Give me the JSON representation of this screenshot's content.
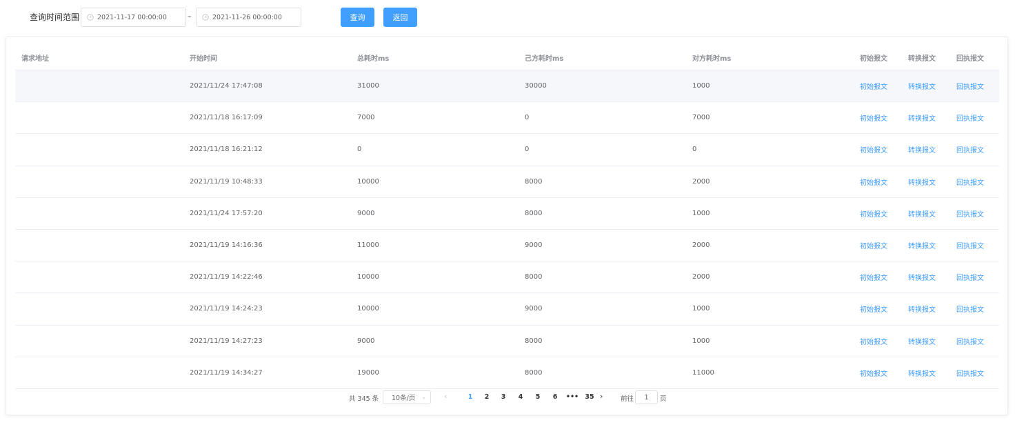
{
  "filter": {
    "range_label": "查询时间范围",
    "start_value": "2021-11-17 00:00:00",
    "end_value": "2021-11-26 00:00:00",
    "separator": "–",
    "query_label": "查询",
    "back_label": "返回"
  },
  "table": {
    "headers": [
      "请求地址",
      "开始时间",
      "总耗时ms",
      "己方耗时ms",
      "对方耗时ms",
      "初始报文",
      "转换报文",
      "回执报文"
    ],
    "rows": [
      {
        "url": "",
        "start": "2021/11/24 17:47:08",
        "total": "31000",
        "own": "30000",
        "other": "1000",
        "l1": "初始报文",
        "l2": "转换报文",
        "l3": "回执报文"
      },
      {
        "url": "",
        "start": "2021/11/18 16:17:09",
        "total": "7000",
        "own": "0",
        "other": "7000",
        "l1": "初始报文",
        "l2": "转换报文",
        "l3": "回执报文"
      },
      {
        "url": "",
        "start": "2021/11/18 16:21:12",
        "total": "0",
        "own": "0",
        "other": "0",
        "l1": "初始报文",
        "l2": "转换报文",
        "l3": "回执报文"
      },
      {
        "url": "",
        "start": "2021/11/19 10:48:33",
        "total": "10000",
        "own": "8000",
        "other": "2000",
        "l1": "初始报文",
        "l2": "转换报文",
        "l3": "回执报文"
      },
      {
        "url": "",
        "start": "2021/11/24 17:57:20",
        "total": "9000",
        "own": "8000",
        "other": "1000",
        "l1": "初始报文",
        "l2": "转换报文",
        "l3": "回执报文"
      },
      {
        "url": "",
        "start": "2021/11/19 14:16:36",
        "total": "11000",
        "own": "9000",
        "other": "2000",
        "l1": "初始报文",
        "l2": "转换报文",
        "l3": "回执报文"
      },
      {
        "url": "",
        "start": "2021/11/19 14:22:46",
        "total": "10000",
        "own": "8000",
        "other": "2000",
        "l1": "初始报文",
        "l2": "转换报文",
        "l3": "回执报文"
      },
      {
        "url": "",
        "start": "2021/11/19 14:24:23",
        "total": "10000",
        "own": "9000",
        "other": "1000",
        "l1": "初始报文",
        "l2": "转换报文",
        "l3": "回执报文"
      },
      {
        "url": "",
        "start": "2021/11/19 14:27:23",
        "total": "9000",
        "own": "8000",
        "other": "1000",
        "l1": "初始报文",
        "l2": "转换报文",
        "l3": "回执报文"
      },
      {
        "url": "",
        "start": "2021/11/19 14:34:27",
        "total": "19000",
        "own": "8000",
        "other": "11000",
        "l1": "初始报文",
        "l2": "转换报文",
        "l3": "回执报文"
      }
    ]
  },
  "pagination": {
    "total_text": "共 345 条",
    "page_size": "10条/页",
    "prev_icon": "chevron-left-icon",
    "next_icon": "chevron-right-icon",
    "pages": [
      "1",
      "2",
      "3",
      "4",
      "5",
      "6",
      "•••",
      "35"
    ],
    "active_page": "1",
    "goto_label": "前往",
    "goto_value": "1",
    "page_unit": "页"
  },
  "colors": {
    "accent": "#409eff",
    "border": "#ebeef5",
    "header_text": "#909399",
    "body_text": "#606266",
    "highlight_row": "#f5f7fa"
  }
}
